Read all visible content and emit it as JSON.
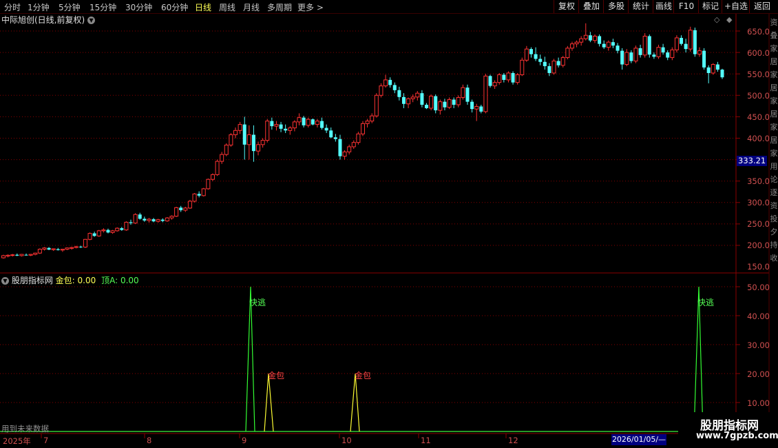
{
  "toolbar": {
    "periods": [
      "分时",
      "1分钟",
      "5分钟",
      "15分钟",
      "30分钟",
      "60分钟",
      "日线",
      "周线",
      "月线",
      "多周期",
      "更多 >"
    ],
    "active_period": "日线",
    "right_buttons": [
      "复权",
      "叠加",
      "多股",
      "统计",
      "画线",
      "F10",
      "标记",
      "+自选",
      "返回"
    ]
  },
  "main_chart": {
    "title": "中际旭创(日线,前复权)",
    "current_price_tag": "333.21",
    "y_axis_labels": [
      "650.0",
      "600.0",
      "550.0",
      "500.0",
      "450.0",
      "400.0",
      "350.0",
      "300.0",
      "250.0",
      "200.0",
      "150.0"
    ],
    "colors": {
      "up": "#ff3333",
      "down": "#54ffff",
      "grid": "#8b0000",
      "axis_text": "#d05050"
    }
  },
  "indicator": {
    "name": "股朋指标网",
    "jinbao_label": "金包:",
    "jinbao_value": "0.00",
    "ding_label": "顶A:",
    "ding_value": "0.00",
    "y_axis_labels": [
      "50.00",
      "40.00",
      "30.00",
      "20.00",
      "10.00"
    ],
    "signal_fast_label": "快逃",
    "signal_gold_label": "金包",
    "warning": "用到未来数据"
  },
  "date_axis": {
    "labels": [
      "2025年",
      "7",
      "8",
      "9",
      "10",
      "11",
      "12"
    ],
    "cursor_date": "2026/01/05/—"
  },
  "sidebar_chars": [
    "资",
    "叠",
    "家",
    "居",
    "家",
    "居",
    "家",
    "居",
    "家",
    "居",
    "家",
    "用",
    "论",
    "逐",
    "资",
    "投",
    "夕",
    "持",
    "收"
  ],
  "watermark": {
    "title": "股朋指标网",
    "url": "www.7gpzb.com"
  },
  "chart_data": {
    "type": "candlestick",
    "title": "中际旭创(日线,前复权)",
    "ylim": [
      110,
      668
    ],
    "ohlc": [
      [
        121,
        128,
        119,
        126
      ],
      [
        125,
        129,
        122,
        127
      ],
      [
        127,
        130,
        124,
        128
      ],
      [
        128,
        131,
        125,
        126
      ],
      [
        126,
        130,
        124,
        129
      ],
      [
        128,
        131,
        126,
        127
      ],
      [
        127,
        130,
        125,
        129
      ],
      [
        129,
        133,
        127,
        132
      ],
      [
        132,
        143,
        130,
        141
      ],
      [
        141,
        146,
        138,
        144
      ],
      [
        144,
        146,
        139,
        140
      ],
      [
        140,
        143,
        137,
        142
      ],
      [
        141,
        144,
        138,
        139
      ],
      [
        139,
        142,
        135,
        141
      ],
      [
        141,
        145,
        139,
        144
      ],
      [
        143,
        147,
        140,
        145
      ],
      [
        145,
        149,
        143,
        147
      ],
      [
        147,
        149,
        144,
        146
      ],
      [
        146,
        165,
        144,
        164
      ],
      [
        164,
        180,
        162,
        178
      ],
      [
        178,
        182,
        170,
        172
      ],
      [
        172,
        186,
        170,
        184
      ],
      [
        184,
        190,
        180,
        186
      ],
      [
        186,
        189,
        178,
        180
      ],
      [
        180,
        186,
        177,
        184
      ],
      [
        184,
        192,
        182,
        190
      ],
      [
        190,
        193,
        184,
        186
      ],
      [
        186,
        206,
        184,
        204
      ],
      [
        204,
        210,
        198,
        202
      ],
      [
        202,
        225,
        200,
        222
      ],
      [
        222,
        226,
        210,
        212
      ],
      [
        212,
        217,
        205,
        208
      ],
      [
        208,
        214,
        203,
        211
      ],
      [
        211,
        214,
        204,
        206
      ],
      [
        206,
        212,
        203,
        210
      ],
      [
        210,
        213,
        204,
        207
      ],
      [
        207,
        216,
        205,
        214
      ],
      [
        214,
        220,
        210,
        218
      ],
      [
        218,
        240,
        216,
        238
      ],
      [
        238,
        242,
        228,
        232
      ],
      [
        232,
        240,
        228,
        237
      ],
      [
        237,
        256,
        235,
        253
      ],
      [
        253,
        272,
        250,
        270
      ],
      [
        270,
        276,
        262,
        266
      ],
      [
        266,
        284,
        264,
        282
      ],
      [
        282,
        306,
        280,
        304
      ],
      [
        304,
        318,
        300,
        315
      ],
      [
        315,
        350,
        312,
        346
      ],
      [
        346,
        368,
        340,
        362
      ],
      [
        362,
        388,
        358,
        384
      ],
      [
        384,
        412,
        380,
        408
      ],
      [
        408,
        425,
        400,
        418
      ],
      [
        418,
        438,
        410,
        432
      ],
      [
        432,
        450,
        350,
        385
      ],
      [
        385,
        430,
        350,
        408
      ],
      [
        408,
        430,
        345,
        370
      ],
      [
        370,
        392,
        360,
        385
      ],
      [
        385,
        400,
        378,
        395
      ],
      [
        395,
        445,
        390,
        440
      ],
      [
        440,
        448,
        420,
        428
      ],
      [
        428,
        440,
        418,
        432
      ],
      [
        432,
        438,
        414,
        422
      ],
      [
        422,
        432,
        412,
        418
      ],
      [
        418,
        428,
        408,
        424
      ],
      [
        424,
        442,
        416,
        438
      ],
      [
        438,
        458,
        430,
        448
      ],
      [
        448,
        452,
        425,
        430
      ],
      [
        430,
        448,
        425,
        444
      ],
      [
        444,
        446,
        430,
        432
      ],
      [
        432,
        445,
        425,
        440
      ],
      [
        440,
        448,
        420,
        424
      ],
      [
        424,
        432,
        412,
        418
      ],
      [
        418,
        425,
        400,
        402
      ],
      [
        402,
        410,
        392,
        398
      ],
      [
        398,
        408,
        350,
        358
      ],
      [
        358,
        372,
        350,
        368
      ],
      [
        368,
        385,
        362,
        380
      ],
      [
        380,
        395,
        375,
        390
      ],
      [
        390,
        415,
        385,
        410
      ],
      [
        410,
        440,
        405,
        434
      ],
      [
        434,
        445,
        425,
        440
      ],
      [
        440,
        458,
        435,
        452
      ],
      [
        452,
        505,
        448,
        500
      ],
      [
        500,
        528,
        495,
        522
      ],
      [
        522,
        548,
        518,
        536
      ],
      [
        536,
        542,
        518,
        524
      ],
      [
        524,
        530,
        505,
        512
      ],
      [
        512,
        520,
        488,
        496
      ],
      [
        496,
        505,
        470,
        480
      ],
      [
        480,
        495,
        470,
        492
      ],
      [
        492,
        502,
        484,
        496
      ],
      [
        496,
        510,
        488,
        505
      ],
      [
        505,
        512,
        472,
        478
      ],
      [
        478,
        482,
        468,
        470
      ],
      [
        470,
        502,
        465,
        498
      ],
      [
        498,
        502,
        458,
        465
      ],
      [
        465,
        490,
        455,
        485
      ],
      [
        485,
        492,
        465,
        472
      ],
      [
        472,
        495,
        468,
        490
      ],
      [
        490,
        495,
        470,
        478
      ],
      [
        478,
        500,
        472,
        495
      ],
      [
        495,
        525,
        490,
        518
      ],
      [
        518,
        525,
        478,
        485
      ],
      [
        485,
        490,
        460,
        468
      ],
      [
        468,
        480,
        440,
        474
      ],
      [
        474,
        478,
        458,
        462
      ],
      [
        462,
        550,
        458,
        545
      ],
      [
        545,
        548,
        518,
        522
      ],
      [
        522,
        535,
        515,
        530
      ],
      [
        530,
        552,
        525,
        548
      ],
      [
        548,
        552,
        530,
        536
      ],
      [
        536,
        556,
        530,
        552
      ],
      [
        552,
        556,
        525,
        530
      ],
      [
        530,
        552,
        525,
        548
      ],
      [
        548,
        588,
        545,
        582
      ],
      [
        582,
        615,
        578,
        608
      ],
      [
        608,
        612,
        588,
        596
      ],
      [
        596,
        612,
        580,
        585
      ],
      [
        585,
        595,
        570,
        578
      ],
      [
        578,
        590,
        560,
        568
      ],
      [
        568,
        575,
        545,
        552
      ],
      [
        552,
        585,
        548,
        580
      ],
      [
        580,
        588,
        565,
        570
      ],
      [
        570,
        592,
        565,
        588
      ],
      [
        588,
        615,
        584,
        610
      ],
      [
        610,
        625,
        604,
        620
      ],
      [
        620,
        628,
        612,
        624
      ],
      [
        624,
        638,
        616,
        632
      ],
      [
        632,
        668,
        628,
        640
      ],
      [
        640,
        648,
        624,
        628
      ],
      [
        628,
        642,
        622,
        638
      ],
      [
        638,
        642,
        614,
        620
      ],
      [
        620,
        628,
        608,
        612
      ],
      [
        612,
        628,
        604,
        624
      ],
      [
        624,
        632,
        610,
        616
      ],
      [
        616,
        622,
        598,
        604
      ],
      [
        604,
        610,
        560,
        572
      ],
      [
        572,
        608,
        568,
        600
      ],
      [
        600,
        605,
        575,
        580
      ],
      [
        580,
        616,
        575,
        610
      ],
      [
        610,
        618,
        588,
        594
      ],
      [
        594,
        645,
        588,
        638
      ],
      [
        638,
        642,
        588,
        595
      ],
      [
        595,
        600,
        585,
        590
      ],
      [
        590,
        618,
        585,
        612
      ],
      [
        612,
        620,
        595,
        600
      ],
      [
        600,
        605,
        582,
        588
      ],
      [
        588,
        612,
        582,
        606
      ],
      [
        606,
        640,
        600,
        634
      ],
      [
        634,
        640,
        616,
        620
      ],
      [
        620,
        632,
        600,
        608
      ],
      [
        608,
        660,
        602,
        652
      ],
      [
        652,
        658,
        590,
        596
      ],
      [
        596,
        612,
        590,
        604
      ],
      [
        604,
        610,
        560,
        565
      ],
      [
        565,
        570,
        528,
        552
      ],
      [
        552,
        575,
        548,
        572
      ],
      [
        572,
        578,
        555,
        560
      ],
      [
        560,
        562,
        538,
        542
      ]
    ],
    "indicator_series": {
      "快逃": [
        {
          "date": "2025-09 start",
          "value": 50
        },
        {
          "date": "end",
          "value": 50
        }
      ],
      "金包": [
        {
          "date": "2025-09",
          "value": 20
        },
        {
          "date": "2025-10",
          "value": 20
        }
      ]
    }
  }
}
